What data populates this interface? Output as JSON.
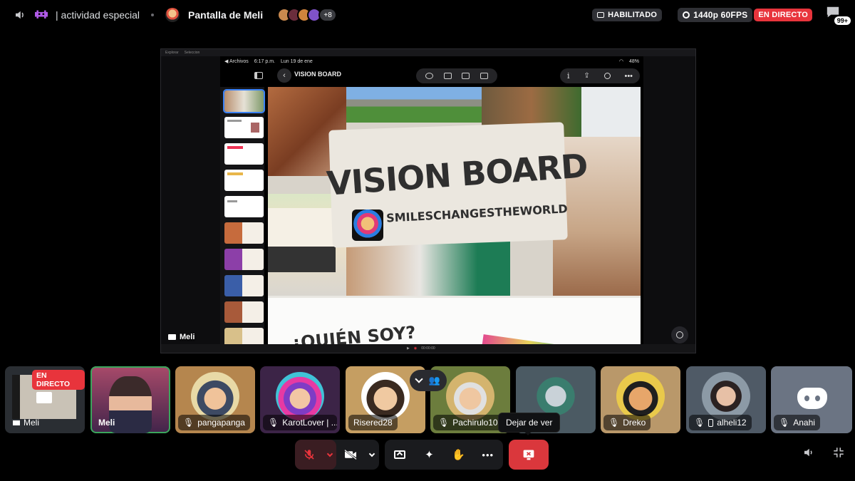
{
  "header": {
    "channel_name": "| actividad especial",
    "screen_title": "Pantalla de Meli",
    "more_count": "+8",
    "enabled_label": "HABILITADO",
    "quality_label": "1440p 60FPS",
    "live_label": "EN DIRECTO",
    "notif_count": "99+"
  },
  "stream": {
    "owner_label": "Meli",
    "top_strip": [
      "Explorar",
      "Seleccion"
    ],
    "ipad_status": {
      "back_label": "◀ Archivos",
      "time": "6:17 p.m.",
      "date": "Lun 19 de ene",
      "battery": "48%"
    },
    "doc_title": "VISION BOARD",
    "slide_title": "VISION BOARD",
    "slide_subtitle": "SMILESCHANGESTHEWORLD",
    "slide2_title": "¿QUIÉN SOY?",
    "bottom_time": "00:00:00"
  },
  "participants": [
    {
      "name": "Meli",
      "live": "EN DIRECTO",
      "color": "#2a2e33"
    },
    {
      "name": "Meli",
      "color": "#6e3f56"
    },
    {
      "name": "pangapanga",
      "color": "#b5864e"
    },
    {
      "name": "KarotLover | ...",
      "color": "#3c2447"
    },
    {
      "name": "Risered28",
      "color": "#c59e62"
    },
    {
      "name": "Pachirulo10",
      "color": "#6c7d3d"
    },
    {
      "name": "",
      "color": "#4b5a63"
    },
    {
      "name": "Dreko",
      "color": "#b9986a"
    },
    {
      "name": "alheli12",
      "color": "#4f5a66"
    },
    {
      "name": "Anahi",
      "color": "#6b7483"
    }
  ],
  "controls": {
    "leave_tooltip": "Dejar de ver"
  },
  "colors": {
    "live_red": "#e8343c",
    "leave_red": "#da373c",
    "accent_green": "#3ba55c"
  }
}
